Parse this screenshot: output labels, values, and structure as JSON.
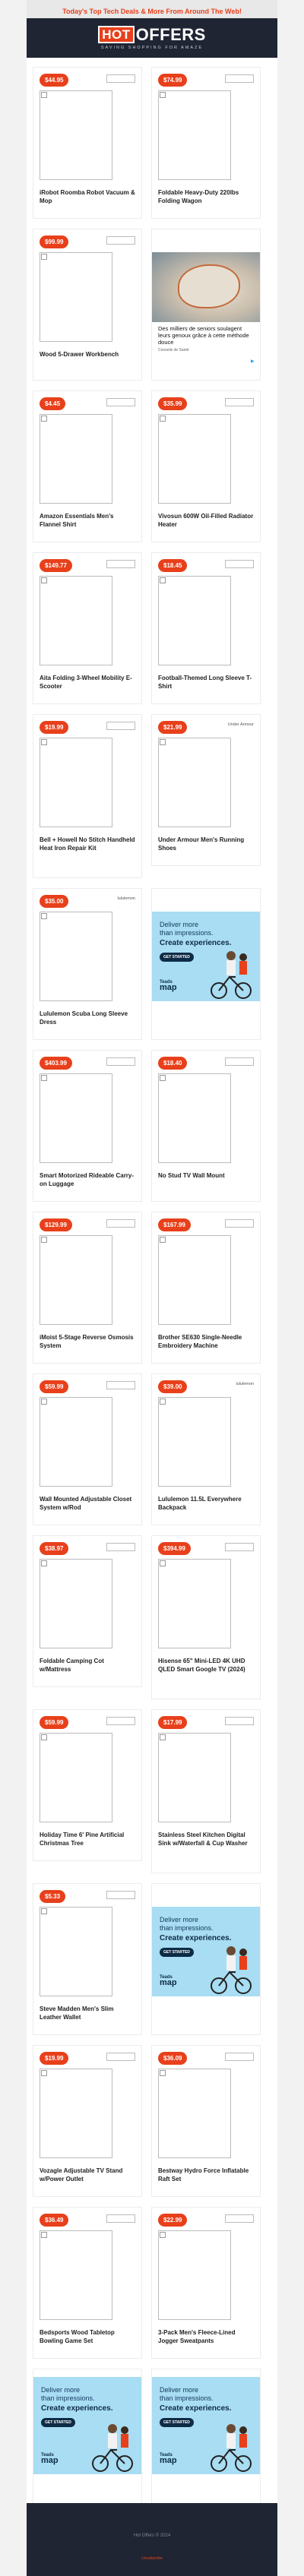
{
  "topbar": {
    "link": "Today's Top Tech Deals & More From Around The Web!"
  },
  "header": {
    "logo_hot": "HOT",
    "logo_offers": "OFFERS",
    "tagline": "SAVING SHOPPING FOR AMAZE"
  },
  "products": [
    {
      "price": "$44.95",
      "title": "iRobot Roomba Robot Vacuum & Mop"
    },
    {
      "price": "$74.99",
      "title": "Foldable Heavy-Duty 220lbs Folding Wagon"
    },
    {
      "price": "$99.99",
      "title": "Wood 5-Drawer Workbench"
    },
    {
      "price": "$4.45",
      "title": "Amazon Essentials Men's Flannel Shirt"
    },
    {
      "price": "$35.99",
      "title": "Vivosun 600W Oil-Filled Radiator Heater"
    },
    {
      "price": "$149.77",
      "title": "Aita Folding 3-Wheel Mobility E-Scooter"
    },
    {
      "price": "$18.45",
      "title": "Football-Themed Long Sleeve T-Shirt"
    },
    {
      "price": "$19.99",
      "title": "Bell + Howell No Stitch Handheld Heat Iron Repair Kit"
    },
    {
      "price": "$21.99",
      "title": "Under Armour Men's Running Shoes"
    },
    {
      "price": "$35.00",
      "title": "Lululemon Scuba Long Sleeve Dress"
    },
    {
      "price": "$403.99",
      "title": "Smart Motorized Rideable Carry-on Luggage"
    },
    {
      "price": "$18.40",
      "title": "No Stud TV Wall Mount"
    },
    {
      "price": "$129.99",
      "title": "iMoist 5-Stage Reverse Osmosis System"
    },
    {
      "price": "$167.99",
      "title": "Brother SE630 Single-Needle Embroidery Machine"
    },
    {
      "price": "$59.99",
      "title": "Wall Mounted Adjustable Closet System w/Rod"
    },
    {
      "price": "$39.00",
      "title": "Lululemon 11.5L Everywhere Backpack"
    },
    {
      "price": "$38.97",
      "title": "Foldable Camping Cot w/Mattress"
    },
    {
      "price": "$394.99",
      "title": "Hisense 65\" Mini-LED 4K UHD QLED Smart Google TV (2024)"
    },
    {
      "price": "$59.99",
      "title": "Holiday Time 6' Pine Artificial Christmas Tree"
    },
    {
      "price": "$17.99",
      "title": "Stainless Steel Kitchen Digital Sink w/Waterfall & Cup Washer"
    },
    {
      "price": "$5.33",
      "title": "Steve Madden Men's Slim Leather Wallet"
    },
    {
      "price": "$19.99",
      "title": "Vozagle Adjustable TV Stand w/Power Outlet"
    },
    {
      "price": "$36.09",
      "title": "Bestway Hydro Force Inflatable Raft Set"
    },
    {
      "price": "$36.49",
      "title": "Bedsports Wood Tabletop Bowling Game Set"
    },
    {
      "price": "$22.99",
      "title": "3-Pack Men's Fleece-Lined Jogger Sweatpants"
    }
  ],
  "stores": {
    "under_armour": "Under Armour",
    "lululemon": "lululemon"
  },
  "ads": {
    "photo": {
      "text": "Des milliers de seniors soulagent leurs genoux grâce à cette méthode douce",
      "sub": "Conseils de Santé"
    },
    "map": {
      "line1a": "Deliver more",
      "line1b": "than impressions.",
      "line2": "Create experiences.",
      "cta": "GET STARTED",
      "brand_a": "Teads",
      "brand_b": "map"
    }
  },
  "footer": {
    "line1": "Hot Offers © 2024",
    "line2": "Unsubscribe"
  }
}
